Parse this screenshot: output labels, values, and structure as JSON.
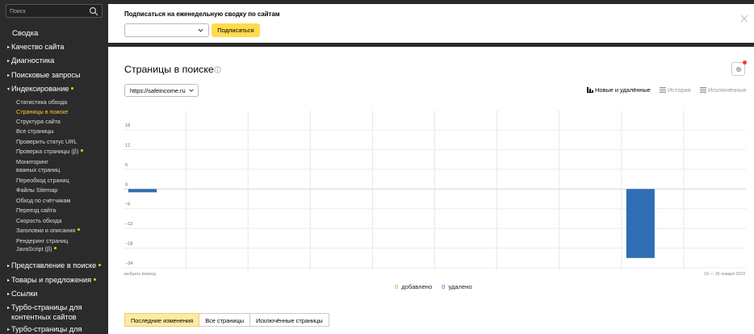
{
  "sidebar": {
    "search_placeholder": "Поиск",
    "summary": "Сводка",
    "sections": [
      {
        "label": "Качество сайта"
      },
      {
        "label": "Диагностика"
      },
      {
        "label": "Поисковые запросы"
      },
      {
        "label": "Индексирование"
      }
    ],
    "indexing_items": [
      {
        "label": "Статистика обхода"
      },
      {
        "label": "Страницы в поиске"
      },
      {
        "label": "Структура сайта"
      },
      {
        "label": "Все страницы"
      },
      {
        "label": "Проверить статус URL"
      },
      {
        "label": "Проверка страницы (β)"
      },
      {
        "label": "Мониторинг"
      },
      {
        "label": "важных страниц"
      },
      {
        "label": "Переобход страниц"
      },
      {
        "label": "Файлы Sitemap"
      },
      {
        "label": "Обход по счётчикам"
      },
      {
        "label": "Переезд сайта"
      },
      {
        "label": "Скорость обхода"
      },
      {
        "label": "Заголовки и описания"
      },
      {
        "label": "Рендеринг страниц"
      },
      {
        "label": "JavaScript (β)"
      }
    ],
    "bottom_sections": [
      {
        "label": "Представление в поиске"
      },
      {
        "label": "Товары и предложения"
      },
      {
        "label": "Ссылки"
      },
      {
        "label": "Турбо-страницы для"
      },
      {
        "label": "контентных сайтов"
      },
      {
        "label": "Турбо-страницы для"
      }
    ]
  },
  "subscribe": {
    "title": "Подписаться на еженедельную сводку по сайтам",
    "button": "Подписаться"
  },
  "main": {
    "title": "Страницы в поиске",
    "site": "https://safeincome.ru",
    "view_tabs": {
      "new_removed": "Новые и удалённые",
      "history": "История",
      "excluded": "Исключённые"
    },
    "period_left": "выбрать период",
    "period_right": "10 — 26 января 2023",
    "legend": {
      "added_count": "0",
      "added_label": "добавлено",
      "removed_count": "0",
      "removed_label": "удалено"
    },
    "tabs": [
      "Последние изменения",
      "Все страницы",
      "Исключённые страницы"
    ]
  },
  "colors": {
    "bar": "#2f6db5",
    "accent_yellow": "#ffdb4d",
    "sidebar_bg": "#2b2b2b",
    "active_link": "#ffcc33",
    "added": "#66cc33",
    "removed": "#1b6bc0"
  },
  "chart_data": {
    "type": "bar",
    "y_ticks": [
      "18",
      "12",
      "6",
      "0",
      "−6",
      "−12",
      "−18",
      "−24"
    ],
    "ylim": [
      -24,
      18
    ],
    "grid": true,
    "bars": [
      {
        "slot": 0,
        "value": -1
      },
      {
        "slot": 8,
        "value": -21
      }
    ],
    "slots": 10
  }
}
